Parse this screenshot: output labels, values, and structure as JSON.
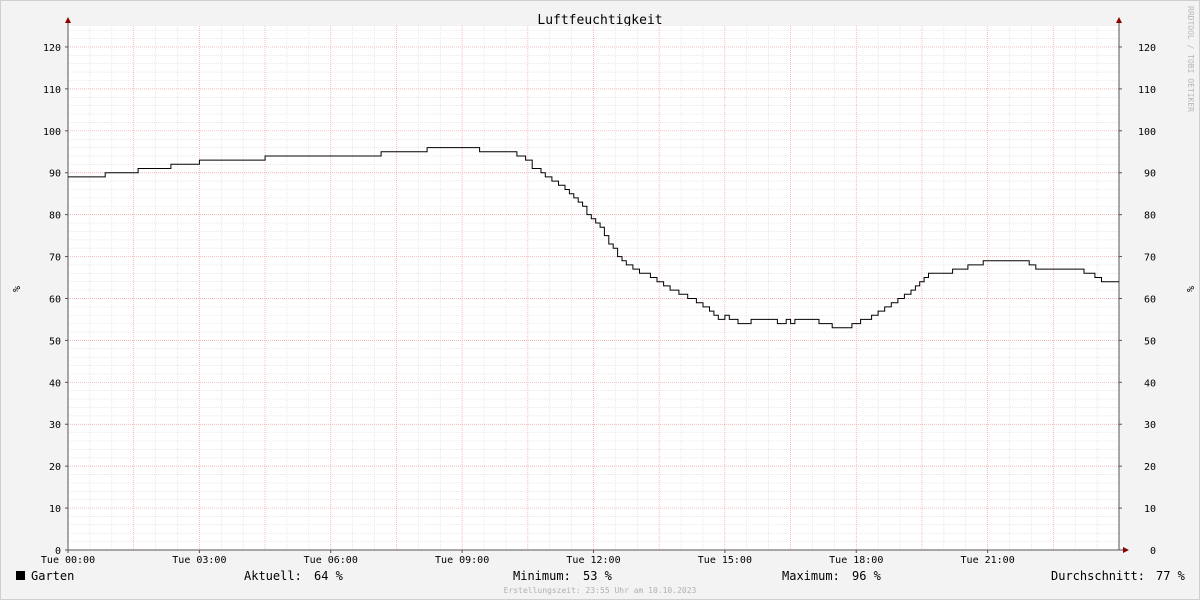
{
  "chart_data": {
    "type": "line",
    "title": "Luftfeuchtigkeit",
    "ylabel": "%",
    "ylim": [
      0,
      125
    ],
    "xlim": [
      0,
      24
    ],
    "y_ticks": [
      0,
      10,
      20,
      30,
      40,
      50,
      60,
      70,
      80,
      90,
      100,
      110,
      120
    ],
    "x_ticks": [
      {
        "value": 0,
        "label": "Tue 00:00"
      },
      {
        "value": 3,
        "label": "Tue 03:00"
      },
      {
        "value": 6,
        "label": "Tue 06:00"
      },
      {
        "value": 9,
        "label": "Tue 09:00"
      },
      {
        "value": 12,
        "label": "Tue 12:00"
      },
      {
        "value": 15,
        "label": "Tue 15:00"
      },
      {
        "value": 18,
        "label": "Tue 18:00"
      },
      {
        "value": 21,
        "label": "Tue 21:00"
      }
    ],
    "grid": true,
    "step": true,
    "series": [
      {
        "name": "Garten",
        "color": "#000000",
        "x": [
          0,
          0.85,
          1.6,
          2.35,
          3.0,
          4.5,
          7.15,
          8.2,
          9.4,
          10.25,
          10.45,
          10.6,
          10.8,
          10.9,
          11.05,
          11.2,
          11.35,
          11.45,
          11.55,
          11.65,
          11.75,
          11.85,
          11.95,
          12.05,
          12.15,
          12.25,
          12.35,
          12.45,
          12.55,
          12.65,
          12.75,
          12.9,
          13.05,
          13.3,
          13.45,
          13.6,
          13.75,
          13.95,
          14.15,
          14.35,
          14.5,
          14.65,
          14.75,
          14.85,
          15.0,
          15.1,
          15.3,
          15.6,
          16.2,
          16.4,
          16.5,
          16.6,
          16.75,
          17.15,
          17.45,
          17.9,
          18.1,
          18.35,
          18.5,
          18.65,
          18.8,
          18.95,
          19.1,
          19.25,
          19.35,
          19.45,
          19.55,
          19.65,
          19.85,
          20.2,
          20.55,
          20.9,
          21.95,
          22.1,
          22.3,
          23.2,
          23.45,
          23.6,
          23.9
        ],
        "values": [
          89,
          90,
          91,
          92,
          93,
          94,
          95,
          96,
          95,
          94,
          93,
          91,
          90,
          89,
          88,
          87,
          86,
          85,
          84,
          83,
          82,
          80,
          79,
          78,
          77,
          75,
          73,
          72,
          70,
          69,
          68,
          67,
          66,
          65,
          64,
          63,
          62,
          61,
          60,
          59,
          58,
          57,
          56,
          55,
          56,
          55,
          54,
          55,
          54,
          55,
          54,
          55,
          55,
          54,
          53,
          54,
          55,
          56,
          57,
          58,
          59,
          60,
          61,
          62,
          63,
          64,
          65,
          66,
          66,
          67,
          68,
          69,
          68,
          67,
          67,
          66,
          65,
          64,
          64
        ]
      }
    ]
  },
  "watermark": "RRDTOOL / TOBI OETIKER",
  "legend": {
    "series_name": "Garten",
    "current_label": "Aktuell:",
    "current_value": "64 %",
    "min_label": "Minimum:",
    "min_value": "53 %",
    "max_label": "Maximum:",
    "max_value": "96 %",
    "avg_label": "Durchschnitt:",
    "avg_value": "77 %"
  },
  "footer": "Erstellungszeit: 23:55 Uhr am 10.10.2023"
}
